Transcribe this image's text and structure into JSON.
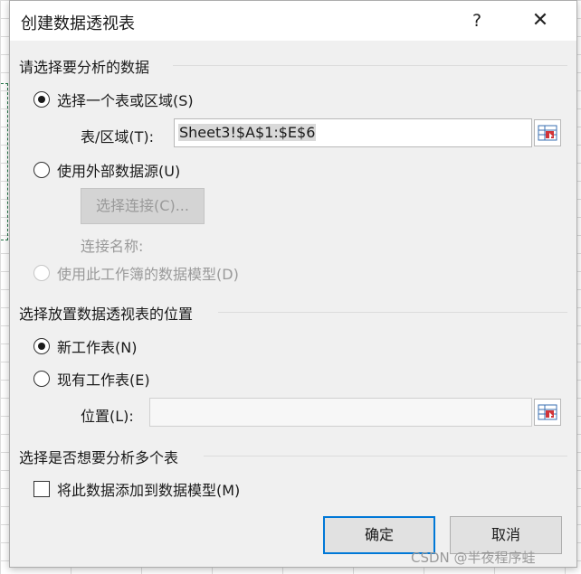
{
  "dialog": {
    "title": "创建数据透视表",
    "help": "?",
    "close": "✕"
  },
  "choose_data": {
    "heading": "请选择要分析的数据",
    "option_table": "选择一个表或区域(S)",
    "table_range_label": "表/区域(T):",
    "table_range_value": "Sheet3!$A$1:$E$6",
    "option_external": "使用外部数据源(U)",
    "choose_connection_button": "选择连接(C)...",
    "connection_name_label": "连接名称:",
    "option_data_model": "使用此工作簿的数据模型(D)"
  },
  "placement": {
    "heading": "选择放置数据透视表的位置",
    "option_new": "新工作表(N)",
    "option_existing": "现有工作表(E)",
    "location_label": "位置(L):",
    "location_value": ""
  },
  "multiple": {
    "heading": "选择是否想要分析多个表",
    "add_to_model": "将此数据添加到数据模型(M)"
  },
  "buttons": {
    "ok": "确定",
    "cancel": "取消"
  },
  "watermark": "CSDN @半夜程序蛙",
  "colors": {
    "accent": "#0078d7",
    "sheet_selection": "#217346"
  }
}
